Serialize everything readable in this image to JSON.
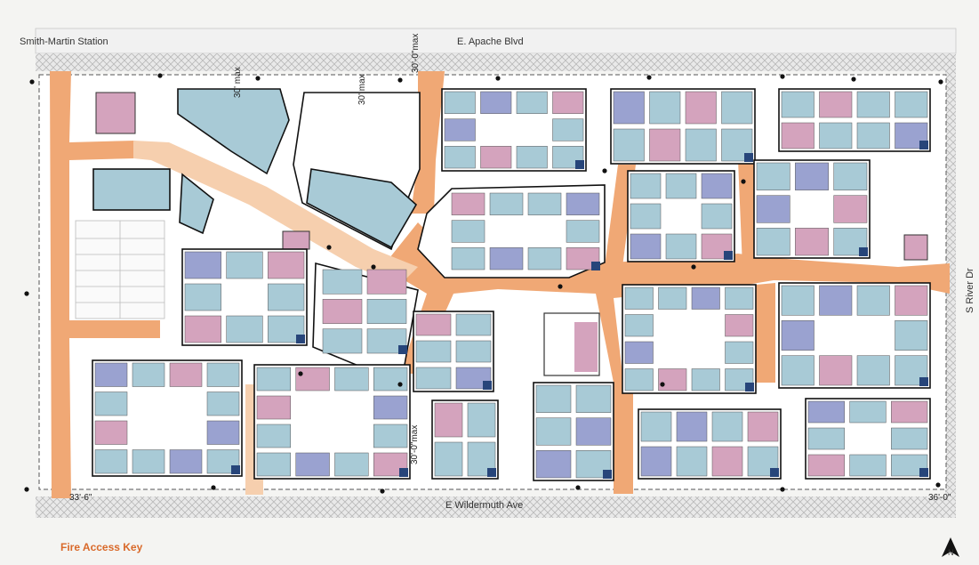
{
  "streets": {
    "north_left": "Smith-Martin Station",
    "north_center": "E. Apache Blvd",
    "south": "E Wildermuth Ave",
    "east": "S River Dr"
  },
  "dimensions": {
    "max_30_a": "30' max",
    "max_30_b": "30' max",
    "max_30_c": "30'-0\"max",
    "max_30_d": "30'-0\"max",
    "left_width": "33'-6\"",
    "right_width": "36'-0\""
  },
  "key": {
    "label": "Fire Access Key",
    "color": "#d9692a"
  },
  "north_arrow": "N",
  "colors": {
    "fire_lane": "#f0a875",
    "fire_lane_light": "#f6cfae",
    "building_light": "#a8cad6",
    "building_mid": "#9aa2d0",
    "building_pink": "#d4a3bd",
    "building_dark": "#27457a",
    "outline": "#111111",
    "hatch": "#cfcfcf"
  }
}
